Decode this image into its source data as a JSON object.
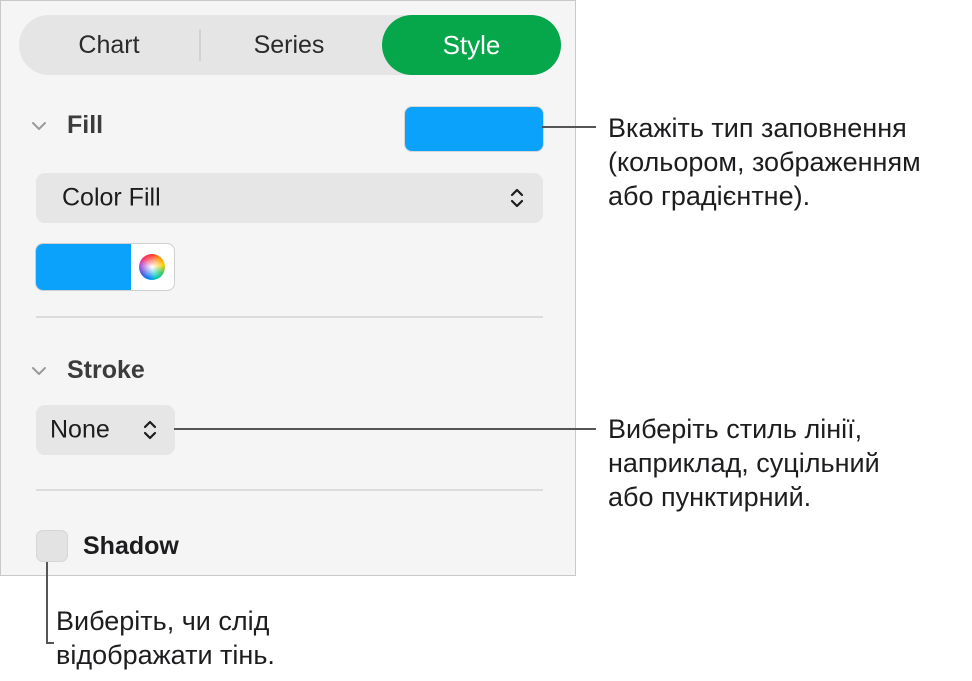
{
  "inspector": {
    "tabs": [
      {
        "label": "Chart",
        "selected": false
      },
      {
        "label": "Series",
        "selected": false
      },
      {
        "label": "Style",
        "selected": true
      }
    ],
    "accent_color": "#06a64a",
    "fill": {
      "title": "Fill",
      "swatch_color": "#0ba2fc",
      "type_value": "Color Fill",
      "color_well": "#0ba2fc",
      "color_wheel_icon": "color-wheel-icon"
    },
    "stroke": {
      "title": "Stroke",
      "style_value": "None"
    },
    "shadow": {
      "label": "Shadow",
      "checked": false
    }
  },
  "callouts": {
    "fill": [
      "Вкажіть тип заповнення",
      "(кольором, зображенням",
      "або градієнтне)."
    ],
    "stroke": [
      "Виберіть стиль лінії,",
      "наприклад, суцільний",
      "або пунктирний."
    ],
    "shadow": [
      "Виберіть, чи слід",
      "відображати тінь."
    ]
  }
}
